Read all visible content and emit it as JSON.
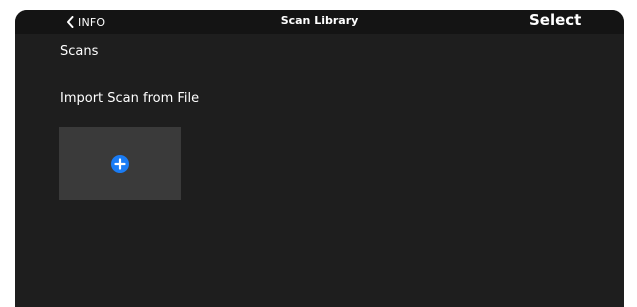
{
  "navbar": {
    "back_label": "INFO",
    "title": "Scan Library",
    "select_label": "Select"
  },
  "content": {
    "section_title": "Scans",
    "import_title": "Import Scan from File"
  },
  "icons": {
    "back": "chevron-left-icon",
    "add": "plus-circle-icon"
  },
  "colors": {
    "background": "#1e1e1e",
    "navbar": "#141414",
    "tile": "#3a3a3a",
    "accent": "#1a7cf5",
    "text": "#ffffff"
  }
}
